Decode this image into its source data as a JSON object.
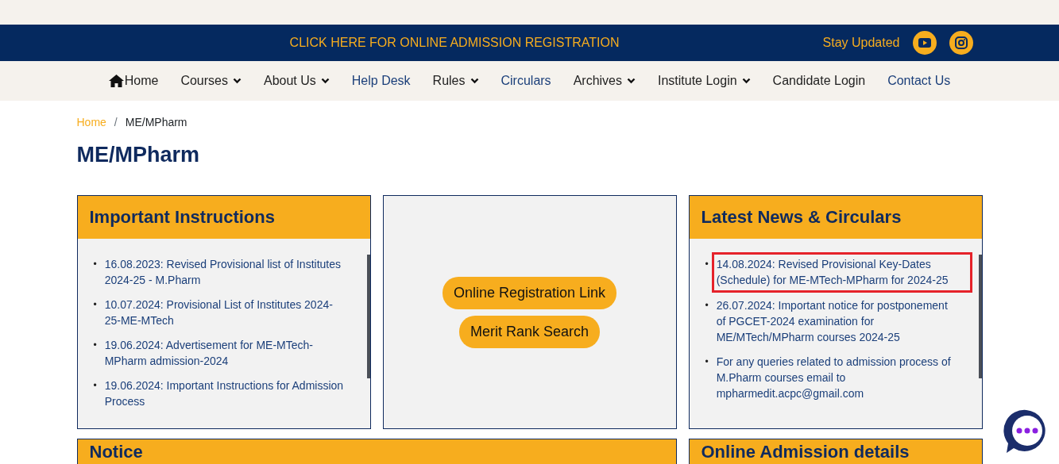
{
  "banner": {
    "link": "CLICK HERE FOR ONLINE ADMISSION REGISTRATION",
    "stay_updated": "Stay Updated"
  },
  "nav": [
    {
      "label": "Home",
      "kind": "home"
    },
    {
      "label": "Courses",
      "kind": "dropdown"
    },
    {
      "label": "About Us",
      "kind": "dropdown"
    },
    {
      "label": "Help Desk",
      "kind": "link"
    },
    {
      "label": "Rules",
      "kind": "dropdown"
    },
    {
      "label": "Circulars",
      "kind": "link"
    },
    {
      "label": "Archives",
      "kind": "dropdown"
    },
    {
      "label": "Institute Login",
      "kind": "dropdown"
    },
    {
      "label": "Candidate Login",
      "kind": "plain"
    },
    {
      "label": "Contact Us",
      "kind": "link"
    }
  ],
  "breadcrumb": [
    "Home",
    "ME/MPharm"
  ],
  "breadcrumb_separator": "/",
  "bullet": "•",
  "page_title": "ME/MPharm",
  "instructions": {
    "title": "Important Instructions",
    "items": [
      {
        "text": "16.08.2023: Revised Provisional list of Institutes 2024-25 - M.Pharm"
      },
      {
        "text": "10.07.2024: Provisional List of Institutes 2024-25-ME-MTech"
      },
      {
        "text": "19.06.2024: Advertisement for ME-MTech-MPharm admission-2024"
      },
      {
        "text": "19.06.2024: Important Instructions for Admission Process"
      }
    ]
  },
  "buttons": [
    "Online Registration Link",
    "Merit Rank Search"
  ],
  "news": {
    "title": "Latest News & Circulars",
    "items": [
      {
        "text": "14.08.2024: Revised Provisional Key-Dates (Schedule) for ME-MTech-MPharm for 2024-25",
        "highlighted": true
      },
      {
        "text": "26.07.2024: Important notice for postponement of PGCET-2024 examination for ME/MTech/MPharm courses 2024-25",
        "highlighted": false
      },
      {
        "text": "For any queries related to admission process of M.Pharm courses email to mpharmedit.acpc@gmail.com",
        "highlighted": false
      }
    ]
  },
  "bottom_cards": [
    "Notice",
    "Online Admission details"
  ]
}
